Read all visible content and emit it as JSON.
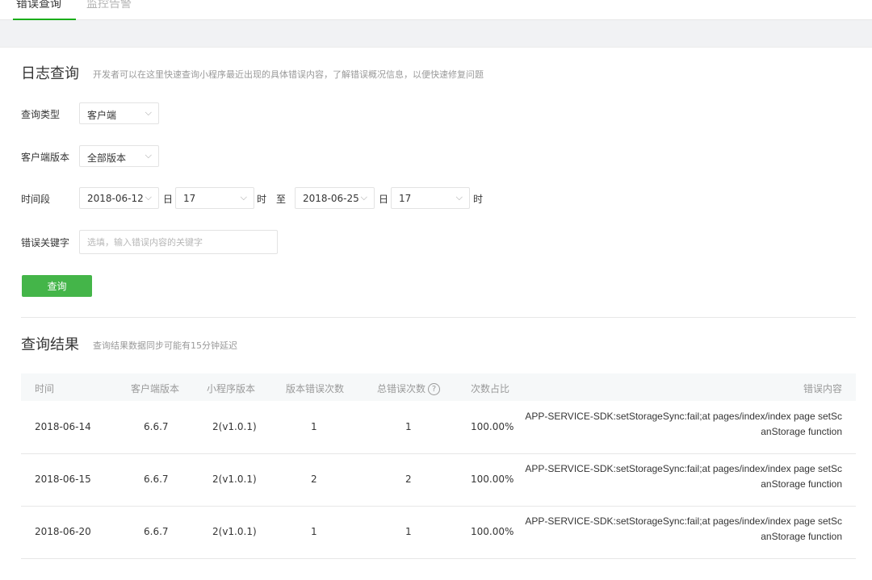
{
  "tabs": [
    {
      "label": "错误查询",
      "active": true
    },
    {
      "label": "监控告警",
      "active": false
    }
  ],
  "log_query": {
    "title": "日志查询",
    "description": "开发者可以在这里快速查询小程序最近出现的具体错误内容，了解错误概况信息，以便快速修复问题"
  },
  "form": {
    "query_type": {
      "label": "查询类型",
      "value": "客户端"
    },
    "client_version": {
      "label": "客户端版本",
      "value": "全部版本"
    },
    "time_range": {
      "label": "时间段",
      "start_date": "2018-06-12",
      "start_day_unit": "日",
      "start_hour": "17",
      "start_hour_unit": "时",
      "to": "至",
      "end_date": "2018-06-25",
      "end_day_unit": "日",
      "end_hour": "17",
      "end_hour_unit": "时"
    },
    "keyword": {
      "label": "错误关键字",
      "value": "",
      "placeholder": "选填，输入错误内容的关键字"
    },
    "query_button": "查询"
  },
  "results": {
    "title": "查询结果",
    "description": "查询结果数据同步可能有15分钟延迟",
    "columns": {
      "time": "时间",
      "client_version": "客户端版本",
      "app_version": "小程序版本",
      "version_errors": "版本错误次数",
      "total_errors": "总错误次数",
      "ratio": "次数占比",
      "content": "错误内容"
    },
    "rows": [
      {
        "time": "2018-06-14",
        "client_version": "6.6.7",
        "app_version": "2(v1.0.1)",
        "version_errors": "1",
        "total_errors": "1",
        "ratio": "100.00%",
        "content_line1": "APP-SERVICE-SDK:setStorageSync:fail;at pages/index/index page setSc",
        "content_line2": "anStorage function"
      },
      {
        "time": "2018-06-15",
        "client_version": "6.6.7",
        "app_version": "2(v1.0.1)",
        "version_errors": "2",
        "total_errors": "2",
        "ratio": "100.00%",
        "content_line1": "APP-SERVICE-SDK:setStorageSync:fail;at pages/index/index page setSc",
        "content_line2": "anStorage function"
      },
      {
        "time": "2018-06-20",
        "client_version": "6.6.7",
        "app_version": "2(v1.0.1)",
        "version_errors": "1",
        "total_errors": "1",
        "ratio": "100.00%",
        "content_line1": "APP-SERVICE-SDK:setStorageSync:fail;at pages/index/index page setSc",
        "content_line2": "anStorage function"
      }
    ]
  },
  "icons": {
    "chevron": "chevron-down-icon",
    "help": "question-circle-icon"
  },
  "colors": {
    "accent": "#44b549",
    "tab_underline": "#1aad19"
  }
}
